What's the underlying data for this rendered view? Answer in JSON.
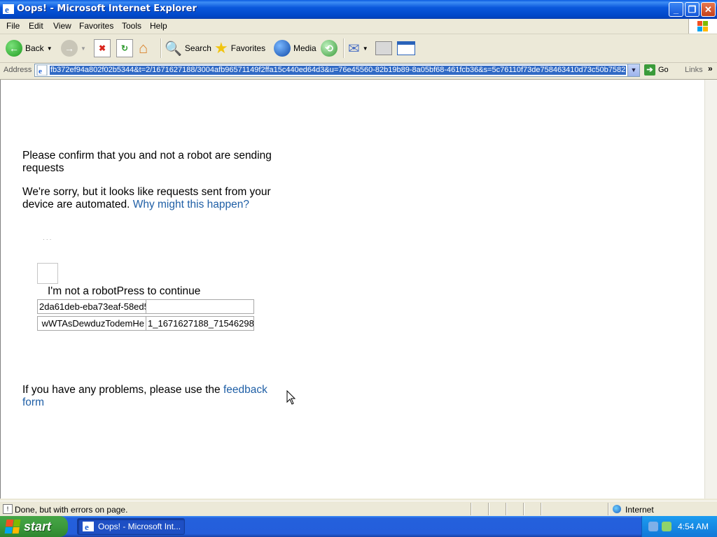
{
  "window": {
    "title": "Oops! - Microsoft Internet Explorer"
  },
  "menu": [
    "File",
    "Edit",
    "View",
    "Favorites",
    "Tools",
    "Help"
  ],
  "toolbar": {
    "back_label": "Back",
    "search_label": "Search",
    "favorites_label": "Favorites",
    "media_label": "Media"
  },
  "address": {
    "label": "Address",
    "url": "fb372ef94a802f02b5344&t=2/1671627188/3004afb96571149f2ffa15c440ed64d3&u=76e45560-82b19b89-8a05bf68-461fcb36&s=5c76110f73de758463410d73c50b7582",
    "go_label": "Go",
    "links_label": "Links"
  },
  "page": {
    "heading": "Please confirm that you and not a robot are sending requests",
    "apology": "We're sorry, but it looks like requests sent from your device are automated.",
    "why_link": "Why might this happen?",
    "robot_label": "I'm not a robotPress to continue",
    "field_1": "2da61deb-eba73eaf-58ed5",
    "field_2": "",
    "field_3": "wWTAsDewduzTodemHe",
    "field_4": "1_1671627188_71546298(",
    "problems_text": "If you have any problems, please use the",
    "feedback_link": "feedback form"
  },
  "status": {
    "text": "Done, but with errors on page.",
    "zone": "Internet"
  },
  "taskbar": {
    "start_label": "start",
    "task_label": "Oops! - Microsoft Int...",
    "clock": "4:54 AM"
  },
  "colors": {
    "link": "#1f5fa6",
    "titlebar": "#0a58dc",
    "start_green": "#3c9a3c"
  }
}
